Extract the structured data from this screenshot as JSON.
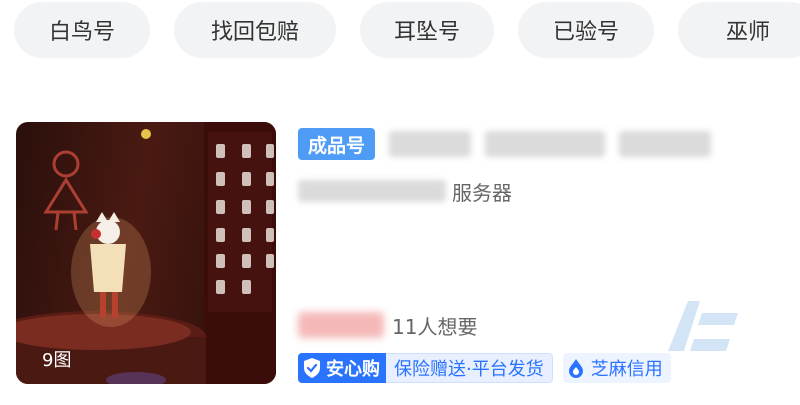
{
  "chips": [
    "白鸟号",
    "找回包赔",
    "耳坠号",
    "已验号",
    "巫师"
  ],
  "product": {
    "image_count": "9图",
    "badge": "成品号",
    "server_suffix": "服务器",
    "want_count": "11人想要",
    "anxin_label": "安心购",
    "insurance_label": "保险赠送·平台发货",
    "credit_label": "芝麻信用"
  },
  "colors": {
    "chip_bg": "#f2f3f5",
    "badge_bg": "#4f9cf7",
    "anxin_blue": "#2a73ff",
    "insure_bg": "#e8f0ff"
  }
}
